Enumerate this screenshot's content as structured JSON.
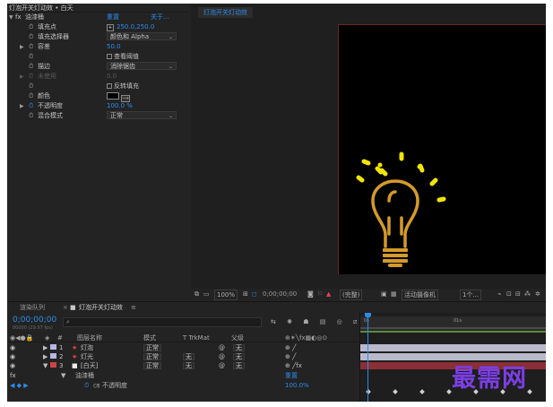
{
  "effect_controls": {
    "header": "灯泡开关灯动效 • 白天",
    "effect_name": "油漆桶",
    "reset_label": "重置",
    "about_label": "关于...",
    "properties": [
      {
        "label": "填充点",
        "value": "250.0,250.0",
        "kind": "point"
      },
      {
        "label": "填充选择器",
        "value": "颜色和 Alpha",
        "kind": "dropdown"
      },
      {
        "label": "容差",
        "value": "50.0",
        "kind": "number",
        "arrow": true
      },
      {
        "label": "",
        "value": "查看阈值",
        "kind": "checkbox"
      },
      {
        "label": "描边",
        "value": "消除锯齿",
        "kind": "dropdown"
      },
      {
        "label": "未使用",
        "value": "0.0",
        "kind": "disabled",
        "arrow": true
      },
      {
        "label": "",
        "value": "反转填充",
        "kind": "checkbox"
      },
      {
        "label": "颜色",
        "value": "",
        "kind": "color"
      },
      {
        "label": "不透明度",
        "value": "100.0 %",
        "kind": "number",
        "arrow": true
      },
      {
        "label": "混合模式",
        "value": "正常",
        "kind": "dropdown"
      }
    ]
  },
  "composition": {
    "tab_label": "灯泡开关灯动效",
    "bulb_color": "#d49a2a",
    "ray_color": "#f2e500",
    "viewer_bar": {
      "zoom": "100%",
      "timecode": "0;00;00;00",
      "resolution": "(完整)",
      "camera": "活动摄像机",
      "views": "1个..."
    }
  },
  "timeline": {
    "tabs": [
      "渲染队列",
      "灯泡开关灯动效"
    ],
    "current_time": "0;00;00;00",
    "fps_text": "00000 (29.97 fps)",
    "search_placeholder": "",
    "columns": {
      "num": "#",
      "source": "图层名称",
      "mode": "模式",
      "trkmat": "T  TrkMat",
      "parent": "父级"
    },
    "layers": [
      {
        "num": "1",
        "name": "灯泡",
        "mode": "正常",
        "trkmat": "",
        "parent": "无",
        "color": "#b7b7e6",
        "track": "#b9b9cc"
      },
      {
        "num": "2",
        "name": "灯光",
        "mode": "正常",
        "trkmat": "无",
        "parent": "无",
        "color": "#b7b7e6",
        "track": "#b9b9cc"
      },
      {
        "num": "3",
        "name": "[白天]",
        "mode": "正常",
        "trkmat": "无",
        "parent": "无",
        "color": "#c44",
        "track": "#8a2f35"
      }
    ],
    "effect_group": "油漆桶",
    "effect_reset": "重置",
    "opacity_label": "不透明度",
    "opacity_value": "100.0%",
    "ruler_marks": [
      "0s",
      "01s"
    ]
  },
  "watermark": "最需网"
}
